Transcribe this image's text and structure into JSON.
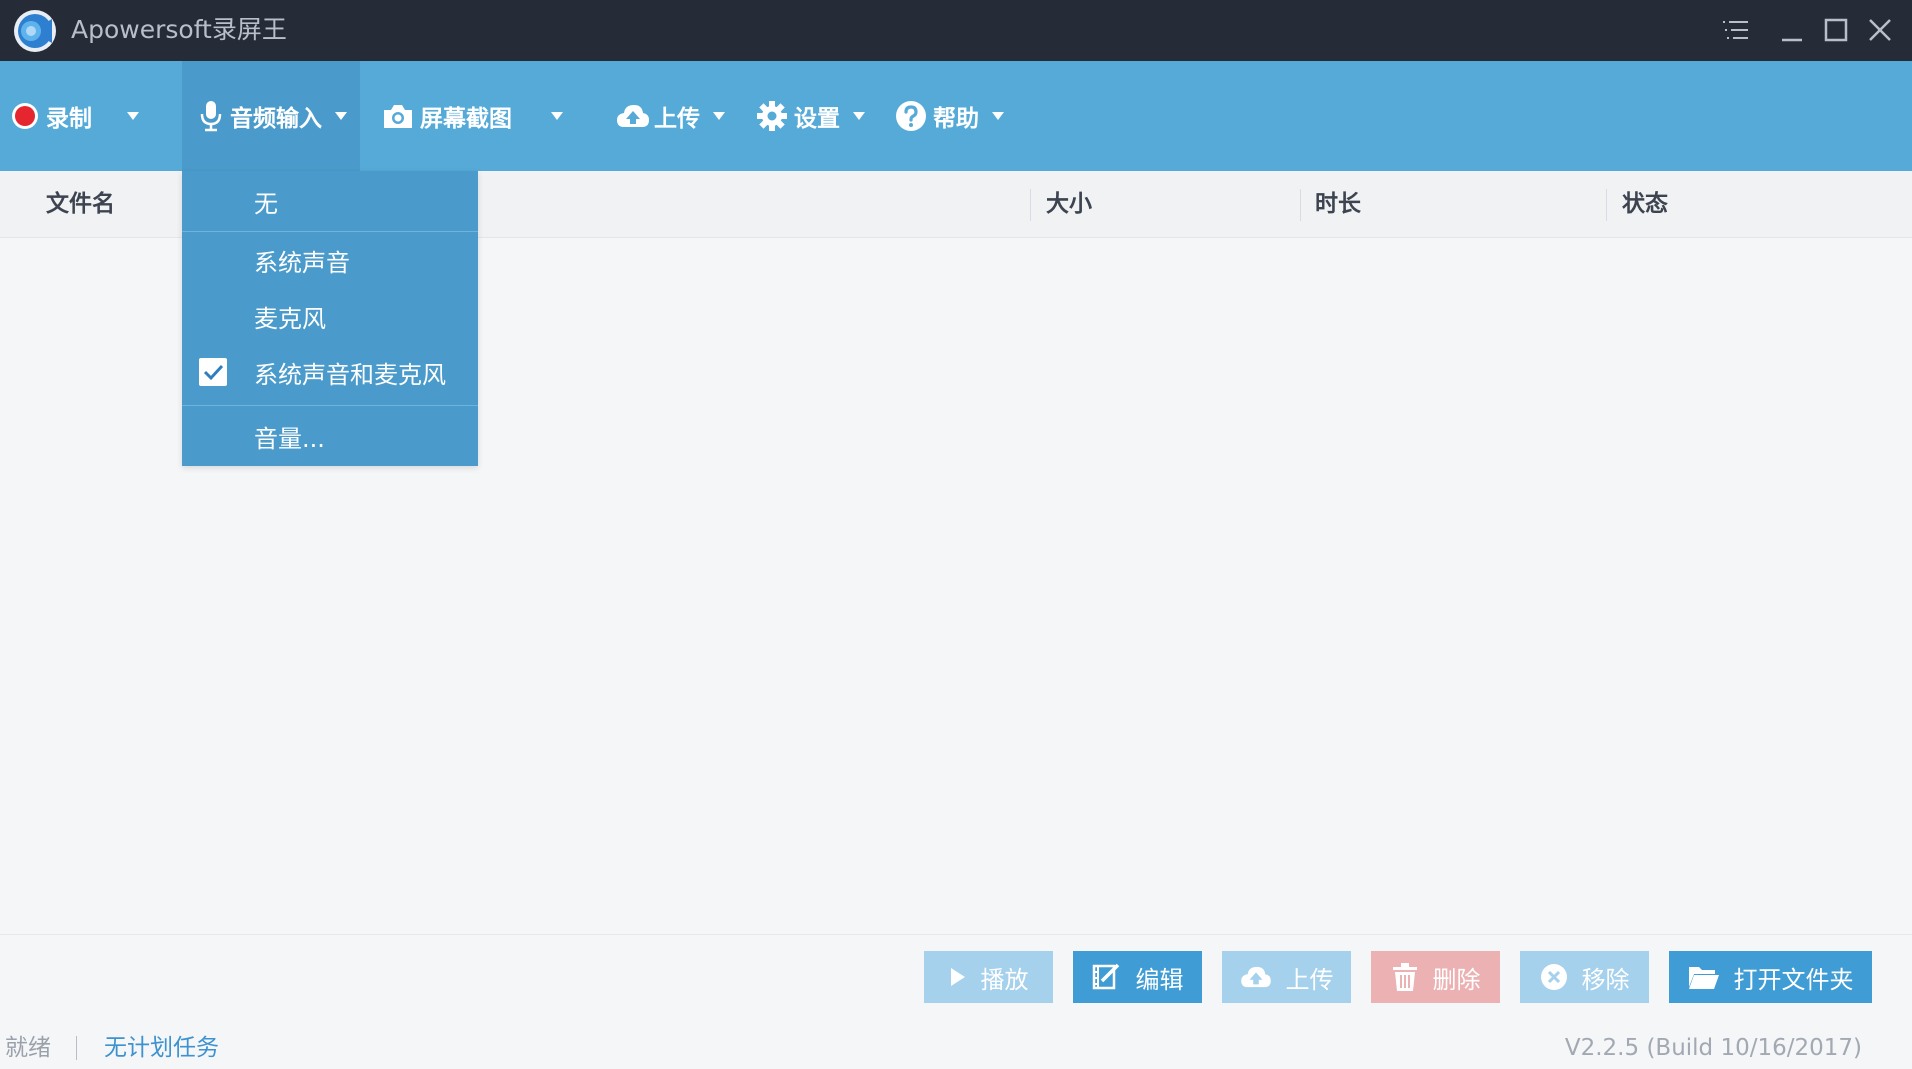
{
  "app": {
    "title": "Apowersoft录屏王"
  },
  "toolbar": {
    "record_label": "录制",
    "audio_input_label": "音频输入",
    "screenshot_label": "屏幕截图",
    "upload_label": "上传",
    "settings_label": "设置",
    "help_label": "帮助"
  },
  "table": {
    "columns": [
      "文件名",
      "大小",
      "时长",
      "状态"
    ],
    "rows": []
  },
  "audio_menu": {
    "items": [
      {
        "label": "无",
        "checked": false
      },
      {
        "label": "系统声音",
        "checked": false
      },
      {
        "label": "麦克风",
        "checked": false
      },
      {
        "label": "系统声音和麦克风",
        "checked": true
      },
      {
        "label": "音量...",
        "checked": false
      }
    ]
  },
  "actions": {
    "play": {
      "label": "播放",
      "color": "#a5d1ec"
    },
    "edit": {
      "label": "编辑",
      "color": "#3f9cd4"
    },
    "upload": {
      "label": "上传",
      "color": "#a5d1ec"
    },
    "delete": {
      "label": "删除",
      "color": "#ebb1b3"
    },
    "remove": {
      "label": "移除",
      "color": "#a5d1ec"
    },
    "open_folder": {
      "label": "打开文件夹",
      "color": "#3f9cd4"
    }
  },
  "status": {
    "ready_text": "就绪",
    "schedule_text": "无计划任务",
    "version_text": "V2.2.5 (Build 10/16/2017)"
  },
  "theme": {
    "titlebar": "#252c38",
    "toolbar": "#56aad8",
    "menu": "#4a9bcb",
    "record_red": "#e5262f"
  }
}
